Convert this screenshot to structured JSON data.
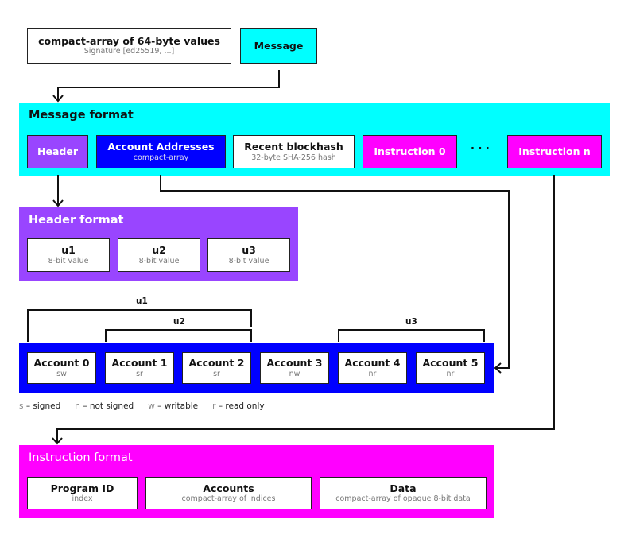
{
  "colors": {
    "cyan": "#00FFFF",
    "purple": "#9945FF",
    "blue": "#0000FF",
    "magenta": "#FF00FF"
  },
  "top": {
    "signatures": {
      "title": "compact-array of 64-byte values",
      "subtitle": "Signature [ed25519, ...]"
    },
    "message": {
      "title": "Message"
    }
  },
  "message_format": {
    "title": "Message format",
    "header": {
      "title": "Header"
    },
    "account_addresses": {
      "title": "Account Addresses",
      "subtitle": "compact-array"
    },
    "recent_blockhash": {
      "title": "Recent blockhash",
      "subtitle": "32-byte SHA-256 hash"
    },
    "instruction_0": {
      "title": "Instruction 0"
    },
    "ellipsis": "· · ·",
    "instruction_n": {
      "title": "Instruction n"
    }
  },
  "header_format": {
    "title": "Header format",
    "fields": [
      {
        "title": "u1",
        "subtitle": "8-bit value"
      },
      {
        "title": "u2",
        "subtitle": "8-bit value"
      },
      {
        "title": "u3",
        "subtitle": "8-bit value"
      }
    ]
  },
  "accounts": {
    "brackets": {
      "u1": "u1",
      "u2": "u2",
      "u3": "u3"
    },
    "items": [
      {
        "title": "Account 0",
        "subtitle": "sw"
      },
      {
        "title": "Account 1",
        "subtitle": "sr"
      },
      {
        "title": "Account 2",
        "subtitle": "sr"
      },
      {
        "title": "Account 3",
        "subtitle": "nw"
      },
      {
        "title": "Account 4",
        "subtitle": "nr"
      },
      {
        "title": "Account 5",
        "subtitle": "nr"
      }
    ]
  },
  "legend": [
    {
      "key": "s",
      "text": " – signed"
    },
    {
      "key": "n",
      "text": " – not signed"
    },
    {
      "key": "w",
      "text": " – writable"
    },
    {
      "key": "r",
      "text": " – read only"
    }
  ],
  "instruction_format": {
    "title": "Instruction format",
    "fields": [
      {
        "title": "Program ID",
        "subtitle": "index"
      },
      {
        "title": "Accounts",
        "subtitle": "compact-array of indices"
      },
      {
        "title": "Data",
        "subtitle": "compact-array of opaque 8-bit data"
      }
    ]
  }
}
